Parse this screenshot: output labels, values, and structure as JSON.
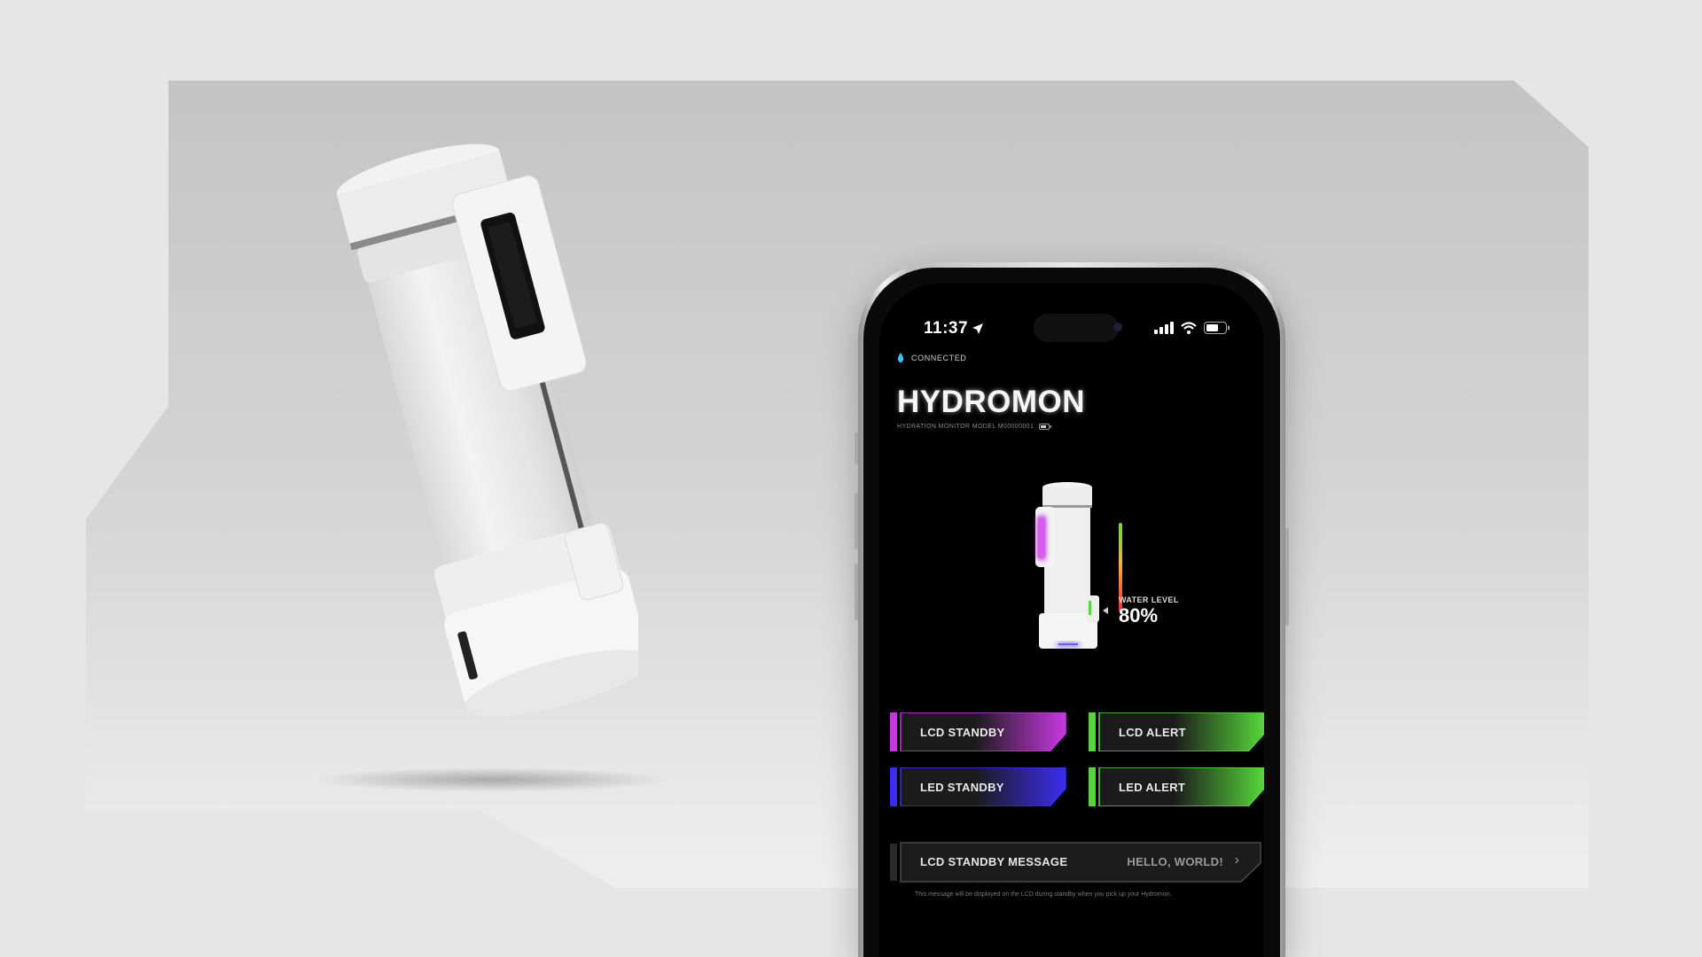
{
  "status": {
    "time": "11:37"
  },
  "app": {
    "connection": "CONNECTED",
    "title": "HYDROMON",
    "subtitle": "HYDRATION MONITOR MODEL M00000001"
  },
  "water_level": {
    "label": "WATER LEVEL",
    "value_text": "80%",
    "value": 0.8
  },
  "controls": {
    "lcd_standby": "LCD STANDBY",
    "lcd_alert": "LCD ALERT",
    "led_standby": "LED STANDBY",
    "led_alert": "LED ALERT"
  },
  "standby_message": {
    "label": "LCD STANDBY MESSAGE",
    "value": "HELLO, WORLD!",
    "note": "This message will be displayed on the LCD during standby when you pick up your Hydromon."
  },
  "colors": {
    "magenta": "#c737e0",
    "blue": "#3b2df0",
    "green": "#56d63a",
    "screen_bg": "#000000"
  }
}
